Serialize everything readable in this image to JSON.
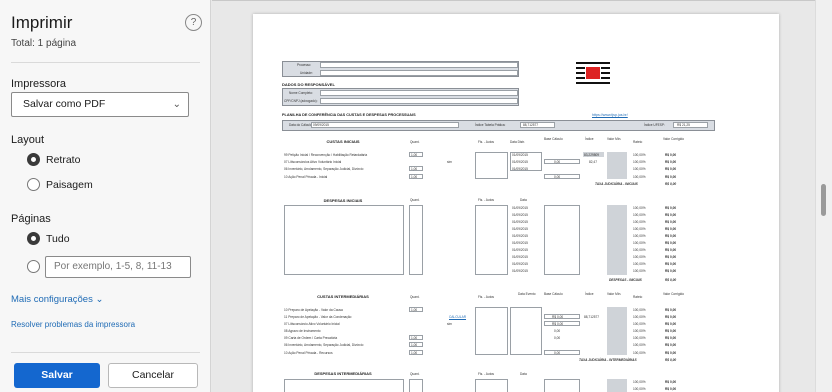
{
  "dialog": {
    "title": "Imprimir",
    "total": "Total: 1 página",
    "help": "?",
    "printer_label": "Impressora",
    "printer_value": "Salvar como PDF",
    "layout_label": "Layout",
    "layout_options": [
      "Retrato",
      "Paisagem"
    ],
    "pages_label": "Páginas",
    "pages_all": "Tudo",
    "pages_placeholder": "Por exemplo, 1-5, 8, 11-13",
    "more_settings": "Mais configurações",
    "troubleshoot": "Resolver problemas da impressora",
    "save": "Salvar",
    "cancel": "Cancelar"
  },
  "document": {
    "field_processo": "Processo:",
    "field_unidade": "Unidade:",
    "responsavel_title": "DADOS DO RESPONSÁVEL",
    "field_nome": "Nome Completo:",
    "field_cpf": "CPF/CNPJ (advogado):",
    "planilha_title": "PLANILHA DE CONFERÊNCIA DAS CUSTAS E DESPESAS PROCESSUAIS",
    "url": "https://www.tjsp.jus.br/",
    "data_calculo_label": "Data do Cálculo:",
    "data_calculo_value": "09/09/2015",
    "indice_tabela_label": "Índice Tabela Prática:",
    "indice_tabela_value": "88,712577",
    "indice_ufesp_label": "Índice UFESP:",
    "indice_ufesp_value": "R$ 21,25",
    "custas_iniciais": {
      "header": "CUSTAS INICIAIS",
      "cols": [
        "Quant.",
        "Fls. - Autos",
        "Data Distr.",
        "Base Cálculo",
        "Índice",
        "Valor Mín.",
        "Rateio",
        "Valor Corrigido"
      ],
      "rows": [
        {
          "label": "99 Petição Inicial / Reconvenção / Habilitação Retardatária",
          "qty": "1,00",
          "date": "01/09/2015",
          "base": "",
          "indice": "83,229809",
          "rateio": "100,00%",
          "valor": "R$ 0,00"
        },
        {
          "label": "07 Litisconsórcios Ativo Voluntário Inicial",
          "qty": "",
          "extra": "sim",
          "date": "01/09/2015",
          "base": "0,00",
          "indice": "82,47",
          "rateio": "100,00%",
          "valor": "R$ 0,00"
        },
        {
          "label": "06 Inventário, Arrolamento, Separação Judicial, Divórcio",
          "qty": "1,00",
          "date": "01/09/2015",
          "base": "",
          "indice": "",
          "rateio": "100,00%",
          "valor": "R$ 0,00"
        },
        {
          "label": "10 Ação Penal Privada - Inicial",
          "qty": "1,00",
          "date": "",
          "base": "0,00",
          "indice": "",
          "rateio": "100,00%",
          "valor": "R$ 0,00"
        }
      ],
      "total_label": "TAXA JUDICIÁRIA - INICIAIS",
      "total_value": "R$ 0,00"
    },
    "despesas_iniciais": {
      "header": "DESPESAS INICIAIS",
      "cols": [
        "Quant.",
        "Fls. - Autos",
        "Data"
      ],
      "dates": [
        "01/09/2015",
        "01/09/2015",
        "01/09/2015",
        "01/09/2015",
        "01/09/2015",
        "01/09/2015",
        "01/09/2015",
        "01/09/2015",
        "01/09/2015",
        "01/09/2015"
      ],
      "rateio": "100,00%",
      "valor": "R$ 0,00",
      "total_label": "DESPESAS - INICIAIS",
      "total_value": "R$ 0,00"
    },
    "custas_intermediarias": {
      "header": "CUSTAS INTERMEDIÁRIAS",
      "cols": [
        "Quant.",
        "Fls. - Autos",
        "Data Evento",
        "Base Cálculo",
        "Índice",
        "Valor Mín.",
        "Rateio",
        "Valor Corrigido"
      ],
      "rows": [
        {
          "label": "10 Preparo de Apelação - Valor da Causa",
          "qty": "1,00",
          "base": "",
          "indice": "",
          "rateio": "100,00%",
          "valor": "R$ 0,00"
        },
        {
          "label": "11 Preparo de Apelação - Valor da Condenação",
          "qty": "",
          "link": "CALCULAR",
          "base": "R$ 0,00",
          "indice": "88,712577",
          "rateio": "100,00%",
          "valor": "R$ 0,00"
        },
        {
          "label": "07 Litisconsórcio Ativo Voluntário Inicial",
          "qty": "",
          "extra": "sim",
          "base": "R$ 0,00",
          "indice": "",
          "rateio": "100,00%",
          "valor": "R$ 0,00"
        },
        {
          "label": "08 Agravo de Instrumento",
          "qty": "",
          "base": "0,00",
          "indice": "",
          "rateio": "100,00%",
          "valor": "R$ 0,00"
        },
        {
          "label": "09 Carta de Ordem / Carta Precatória",
          "qty": "1,00",
          "base": "0,00",
          "indice": "",
          "rateio": "100,00%",
          "valor": "R$ 0,00"
        },
        {
          "label": "06 Inventário, Arrolamento, Separação Judicial, Divórcio",
          "qty": "1,00",
          "base": "",
          "indice": "",
          "rateio": "100,00%",
          "valor": "R$ 0,00"
        },
        {
          "label": "10 Ação Penal Privada - Recursos",
          "qty": "1,00",
          "base": "0,00",
          "indice": "",
          "rateio": "100,00%",
          "valor": "R$ 0,00"
        }
      ],
      "total_label": "TAXA JUDICIÁRIA - INTERMEDIÁRIAS",
      "total_value": "R$ 0,00"
    },
    "despesas_intermediarias": {
      "header": "DESPESAS INTERMEDIÁRIAS",
      "cols": [
        "Quant.",
        "Fls. - Autos",
        "Data"
      ],
      "rateio": "100,00%",
      "valor": "R$ 0,00"
    }
  },
  "colors": {
    "accent": "#1467cf",
    "link": "#1f6bb5",
    "panel_bg": "#f7f7f7",
    "header_bar": "#d9dde3"
  },
  "icons": [
    "help-icon",
    "chevron-down-icon",
    "radio-icon"
  ]
}
